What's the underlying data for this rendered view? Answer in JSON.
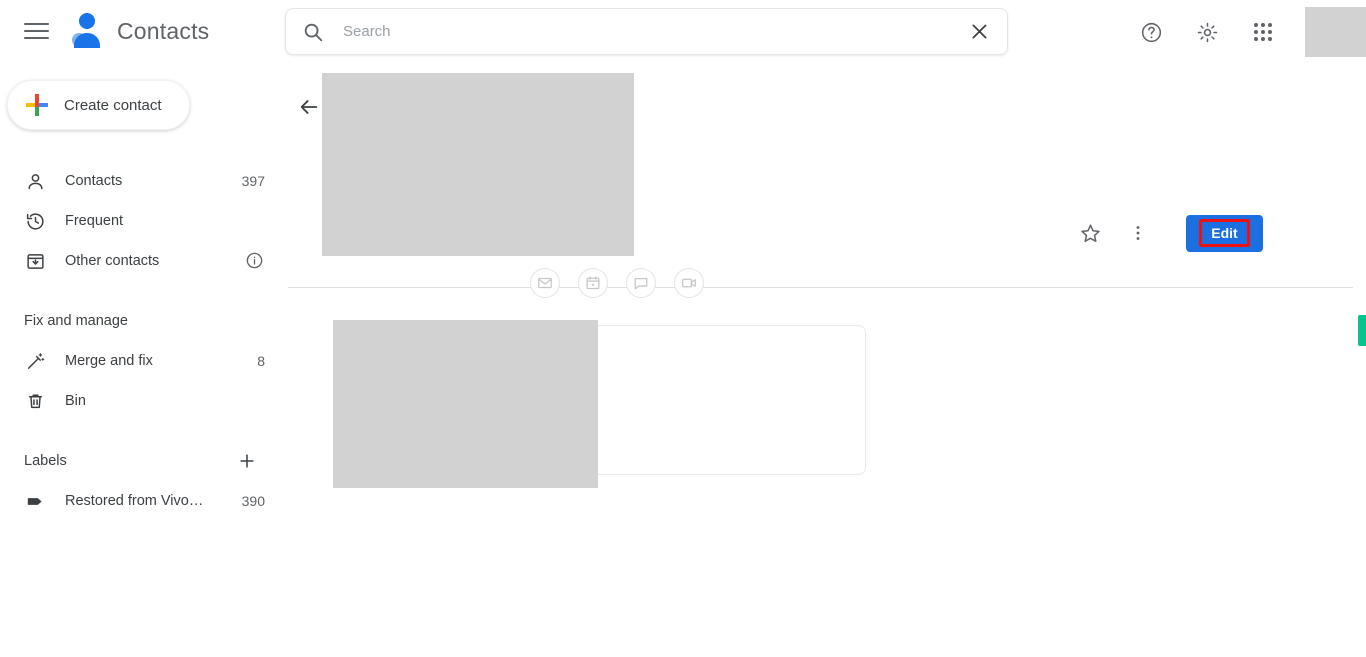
{
  "app": {
    "title": "Contacts",
    "brand_icon": "contacts-person-icon",
    "menu_icon": "hamburger-menu-icon"
  },
  "search": {
    "placeholder": "Search",
    "value": "",
    "search_icon": "search-icon",
    "clear_icon": "close-icon"
  },
  "topbar": {
    "help_icon": "help-circle-icon",
    "settings_icon": "gear-icon",
    "apps_icon": "apps-grid-icon",
    "avatar": "account-avatar-redacted"
  },
  "sidebar": {
    "create_button": {
      "label": "Create contact",
      "icon": "plus-icon"
    },
    "items": [
      {
        "label": "Contacts",
        "count": "397",
        "icon": "person-outline-icon"
      },
      {
        "label": "Frequent",
        "count": "",
        "icon": "history-clock-icon"
      },
      {
        "label": "Other contacts",
        "count": "",
        "icon": "archive-box-icon",
        "info_icon": "info-circle-icon"
      }
    ],
    "fix_and_manage": {
      "title": "Fix and manage",
      "items": [
        {
          "label": "Merge and fix",
          "count": "8",
          "icon": "magic-wand-icon"
        },
        {
          "label": "Bin",
          "count": "",
          "icon": "trash-bin-icon"
        }
      ]
    },
    "labels": {
      "title": "Labels",
      "add_icon": "plus-icon",
      "items": [
        {
          "label": "Restored from Vivo…",
          "count": "390",
          "icon": "tag-icon"
        }
      ]
    }
  },
  "main": {
    "back_icon": "arrow-left-icon",
    "hero_photo": "contact-header-redacted",
    "star_icon": "star-outline-icon",
    "more_icon": "more-vert-icon",
    "edit_button": {
      "label": "Edit",
      "background_color": "#1b6fe0",
      "highlight_color": "#ee1111",
      "text_color": "#ffffff"
    },
    "quick_actions": [
      {
        "name": "email-action",
        "icon": "envelope-icon"
      },
      {
        "name": "calendar-action",
        "icon": "calendar-icon"
      },
      {
        "name": "chat-action",
        "icon": "chat-bubble-icon"
      },
      {
        "name": "video-call-action",
        "icon": "video-camera-icon"
      }
    ],
    "detail_card": "contact-details-card",
    "detail_redacted": "contact-details-redacted"
  },
  "misc": {
    "green_indicator_color": "#06c48e"
  }
}
